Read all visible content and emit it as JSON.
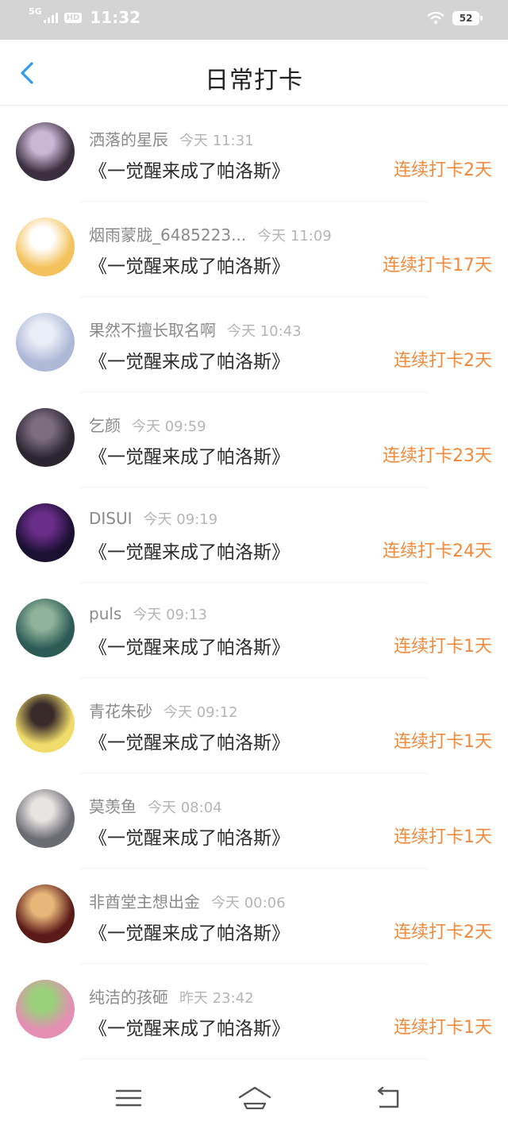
{
  "status_bar": {
    "network": "5G",
    "hd": "HD",
    "time": "11:32",
    "battery": "52"
  },
  "header": {
    "title": "日常打卡",
    "back_icon": "chevron-left-icon",
    "accent": "#2f9bf0"
  },
  "checkins": [
    {
      "name": "洒落的星辰",
      "time": "今天 11:31",
      "book": "《一觉醒来成了帕洛斯》",
      "streak": "连续打卡2天",
      "avatar_colors": [
        "#3b2f3f",
        "#c9b7d6"
      ]
    },
    {
      "name": "烟雨蒙胧_6485223...",
      "time": "今天 11:09",
      "book": "《一觉醒来成了帕洛斯》",
      "streak": "连续打卡17天",
      "avatar_colors": [
        "#f4c25c",
        "#ffffff"
      ]
    },
    {
      "name": "果然不擅长取名啊",
      "time": "今天 10:43",
      "book": "《一觉醒来成了帕洛斯》",
      "streak": "连续打卡2天",
      "avatar_colors": [
        "#aeb9d8",
        "#e9edf7"
      ]
    },
    {
      "name": "乞颜",
      "time": "今天 09:59",
      "book": "《一觉醒来成了帕洛斯》",
      "streak": "连续打卡23天",
      "avatar_colors": [
        "#2a2530",
        "#7b6c80"
      ]
    },
    {
      "name": "DISUI",
      "time": "今天 09:19",
      "book": "《一觉醒来成了帕洛斯》",
      "streak": "连续打卡24天",
      "avatar_colors": [
        "#1a1032",
        "#6a2d8a"
      ]
    },
    {
      "name": "puls",
      "time": "今天 09:13",
      "book": "《一觉醒来成了帕洛斯》",
      "streak": "连续打卡1天",
      "avatar_colors": [
        "#2c5a55",
        "#8fb39a"
      ]
    },
    {
      "name": "青花朱砂",
      "time": "今天 09:12",
      "book": "《一觉醒来成了帕洛斯》",
      "streak": "连续打卡1天",
      "avatar_colors": [
        "#f0dc6a",
        "#3a2b2b"
      ]
    },
    {
      "name": "莫羡鱼",
      "time": "今天 08:04",
      "book": "《一觉醒来成了帕洛斯》",
      "streak": "连续打卡1天",
      "avatar_colors": [
        "#6b6b74",
        "#e8e4e2"
      ]
    },
    {
      "name": "非酋堂主想出金",
      "time": "今天 00:06",
      "book": "《一觉醒来成了帕洛斯》",
      "streak": "连续打卡2天",
      "avatar_colors": [
        "#5a1b18",
        "#e9b67a"
      ]
    },
    {
      "name": "纯洁的孩砸",
      "time": "昨天 23:42",
      "book": "《一觉醒来成了帕洛斯》",
      "streak": "连续打卡1天",
      "avatar_colors": [
        "#e58fb4",
        "#9ad07a"
      ]
    }
  ],
  "colors": {
    "streak": "#f08a3c",
    "name": "#8a8a8a",
    "time": "#b5b5b5"
  },
  "bottom_nav": [
    "menu-icon",
    "home-icon",
    "back-icon"
  ]
}
